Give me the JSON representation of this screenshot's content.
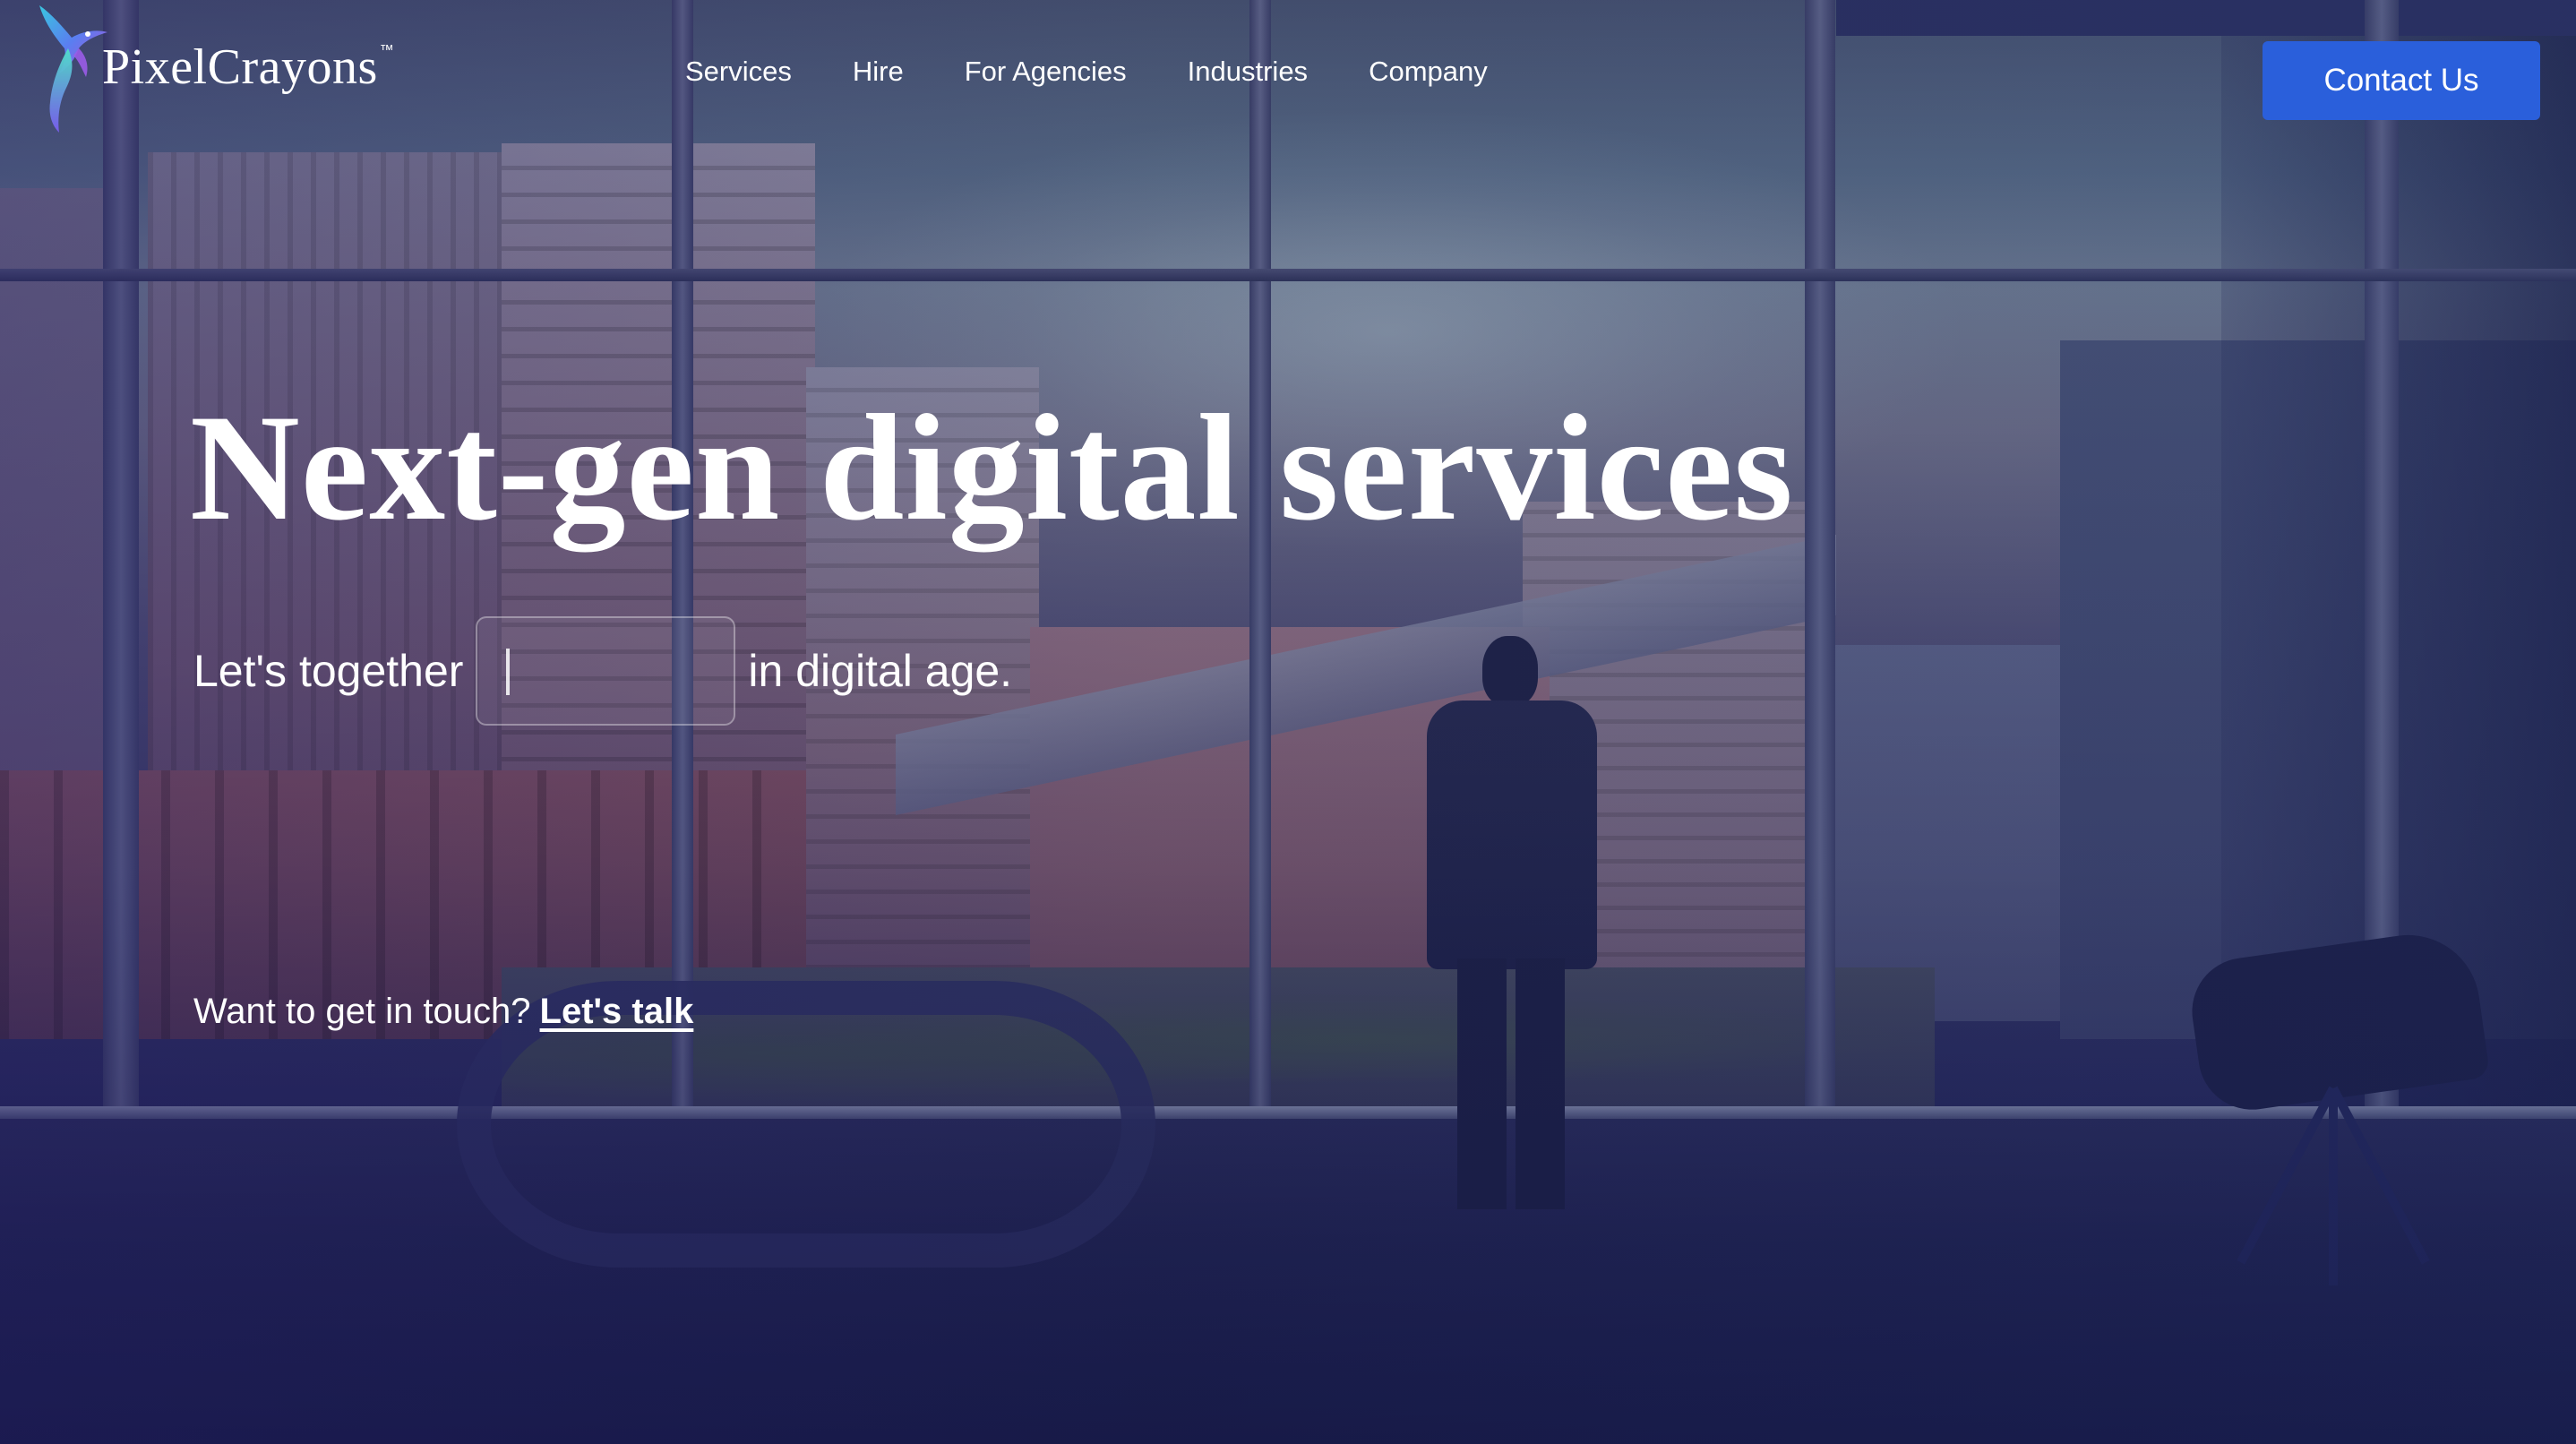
{
  "brand": {
    "name": "PixelCrayons",
    "trademark": "™"
  },
  "nav": {
    "items": [
      {
        "label": "Services"
      },
      {
        "label": "Hire"
      },
      {
        "label": "For Agencies"
      },
      {
        "label": "Industries"
      },
      {
        "label": "Company"
      }
    ],
    "contact_label": "Contact Us"
  },
  "hero": {
    "title": "Next-gen digital services",
    "tagline_before": "Let's together",
    "typed_value": "",
    "tagline_after": "in digital age.",
    "cta_prompt": "Want to get in touch?",
    "cta_link": "Let's talk"
  },
  "colors": {
    "button_bg": "#2a5fdb",
    "text": "#ffffff",
    "overlay": "#1b2150"
  },
  "icons": {
    "logo": "hummingbird-logo-icon",
    "caret": "text-caret-icon"
  }
}
